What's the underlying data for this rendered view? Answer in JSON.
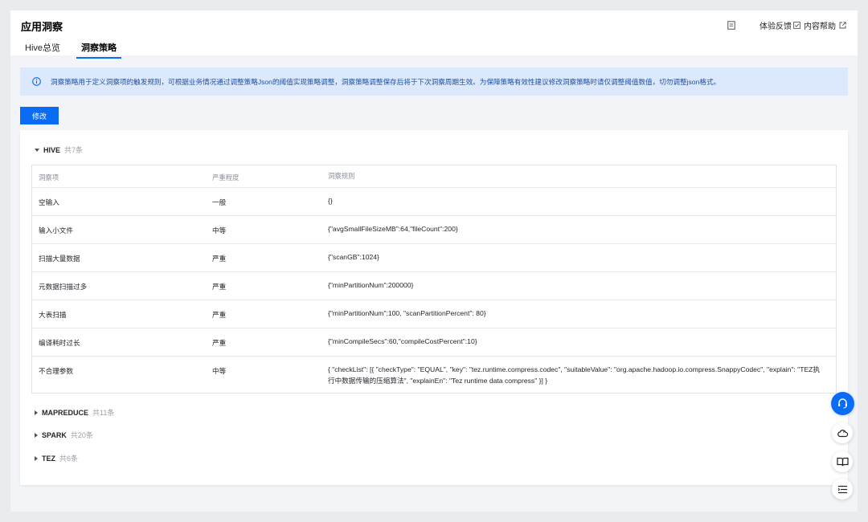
{
  "header": {
    "title": "应用洞察",
    "feedback": "体验反馈",
    "help": "内容帮助"
  },
  "tabs": [
    {
      "label": "Hive总览",
      "active": false
    },
    {
      "label": "洞察策略",
      "active": true
    }
  ],
  "notice": {
    "text": "洞察策略用于定义洞察项的触发规则，可根据业务情况通过调整策略Json的阈值实现策略调整，洞察策略调整保存后将于下次洞察周期生效。为保障策略有效性建议修改洞察策略时请仅调整阈值数值，切勿调整json格式。"
  },
  "edit_button": "修改",
  "groups": [
    {
      "name": "HIVE",
      "count": "共7条",
      "expanded": true
    },
    {
      "name": "MAPREDUCE",
      "count": "共11条",
      "expanded": false
    },
    {
      "name": "SPARK",
      "count": "共20条",
      "expanded": false
    },
    {
      "name": "TEZ",
      "count": "共6条",
      "expanded": false
    }
  ],
  "table": {
    "columns": [
      "洞察项",
      "严重程度",
      "洞察规则"
    ],
    "rows": [
      {
        "item": "空输入",
        "severity": "一般",
        "rule": "{}"
      },
      {
        "item": "输入小文件",
        "severity": "中等",
        "rule": "{\"avgSmallFileSizeMB\":64,\"fileCount\":200}"
      },
      {
        "item": "扫描大量数据",
        "severity": "严重",
        "rule": "{\"scanGB\":1024}"
      },
      {
        "item": "元数据扫描过多",
        "severity": "严重",
        "rule": "{\"minPartitionNum\":200000}"
      },
      {
        "item": "大表扫描",
        "severity": "严重",
        "rule": "{\"minPartitionNum\":100, \"scanPartitionPercent\": 80}"
      },
      {
        "item": "编译耗时过长",
        "severity": "严重",
        "rule": "{\"minCompileSecs\":60,\"compileCostPercent\":10}"
      },
      {
        "item": "不合理参数",
        "severity": "中等",
        "rule": "{ \"checkList\": [{ \"checkType\": \"EQUAL\", \"key\": \"tez.runtime.compress.codec\", \"suitableValue\": \"org.apache.hadoop.io.compress.SnappyCodec\", \"explain\": \"TEZ执行中数据传输的压缩算法\", \"explainEn\": \"Tez runtime data compress\" }] }"
      }
    ]
  },
  "colors": {
    "primary": "#0a6cf5",
    "notice_bg": "#dce9fd",
    "notice_text": "#1e4d9c"
  },
  "floating_icons": [
    "headset-icon",
    "cloud-icon",
    "book-icon",
    "list-icon"
  ]
}
